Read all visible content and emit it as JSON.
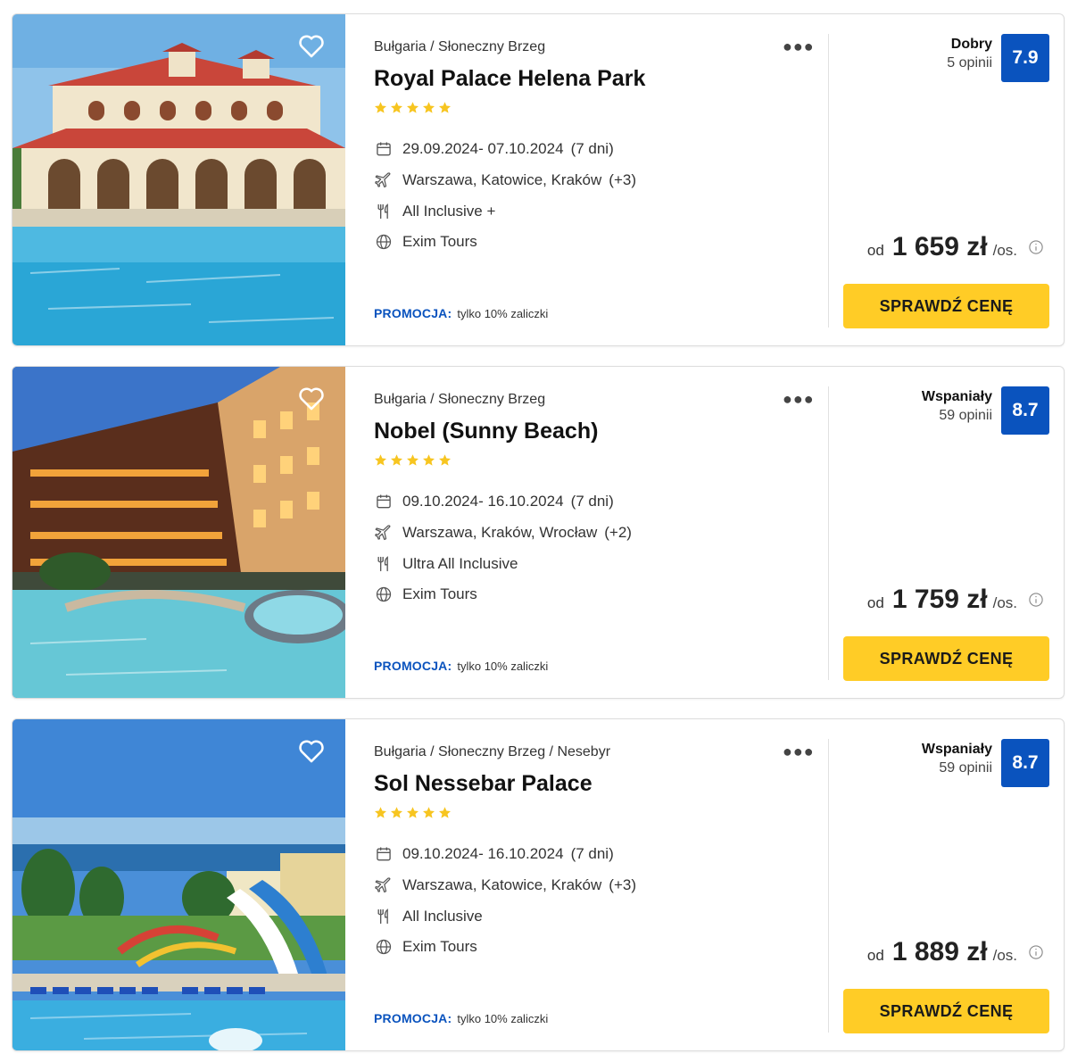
{
  "colors": {
    "brand_blue": "#0a53be",
    "cta_yellow": "#ffcc26",
    "star_yellow": "#f7c520"
  },
  "offers": [
    {
      "location": "Bułgaria / Słoneczny Brzeg",
      "name": "Royal Palace Helena Park",
      "stars": 5,
      "dates": "29.09.2024- 07.10.2024",
      "duration": "(7 dni)",
      "departures": "Warszawa, Katowice, Kraków",
      "departures_more": "(+3)",
      "board": "All Inclusive +",
      "operator": "Exim Tours",
      "promo_label": "PROMOCJA:",
      "promo_text": "tylko 10% zaliczki",
      "rating_word": "Dobry",
      "rating_count": "5 opinii",
      "rating_score": "7.9",
      "price_prefix": "od",
      "price": "1 659 zł",
      "price_suffix": "/os.",
      "cta": "SPRAWDŹ CENĘ",
      "icons": [
        "heart-icon",
        "more-dots-icon",
        "calendar-icon",
        "plane-icon",
        "cutlery-icon",
        "globe-icon",
        "info-icon"
      ]
    },
    {
      "location": "Bułgaria / Słoneczny Brzeg",
      "name": "Nobel (Sunny Beach)",
      "stars": 5,
      "dates": "09.10.2024- 16.10.2024",
      "duration": "(7 dni)",
      "departures": "Warszawa, Kraków, Wrocław",
      "departures_more": "(+2)",
      "board": "Ultra All Inclusive",
      "operator": "Exim Tours",
      "promo_label": "PROMOCJA:",
      "promo_text": "tylko 10% zaliczki",
      "rating_word": "Wspaniały",
      "rating_count": "59 opinii",
      "rating_score": "8.7",
      "price_prefix": "od",
      "price": "1 759 zł",
      "price_suffix": "/os.",
      "cta": "SPRAWDŹ CENĘ",
      "icons": [
        "heart-icon",
        "more-dots-icon",
        "calendar-icon",
        "plane-icon",
        "cutlery-icon",
        "globe-icon",
        "info-icon"
      ]
    },
    {
      "location": "Bułgaria / Słoneczny Brzeg / Nesebyr",
      "name": "Sol Nessebar Palace",
      "stars": 5,
      "dates": "09.10.2024- 16.10.2024",
      "duration": "(7 dni)",
      "departures": "Warszawa, Katowice, Kraków",
      "departures_more": "(+3)",
      "board": "All Inclusive",
      "operator": "Exim Tours",
      "promo_label": "PROMOCJA:",
      "promo_text": "tylko 10% zaliczki",
      "rating_word": "Wspaniały",
      "rating_count": "59 opinii",
      "rating_score": "8.7",
      "price_prefix": "od",
      "price": "1 889 zł",
      "price_suffix": "/os.",
      "cta": "SPRAWDŹ CENĘ",
      "icons": [
        "heart-icon",
        "more-dots-icon",
        "calendar-icon",
        "plane-icon",
        "cutlery-icon",
        "globe-icon",
        "info-icon"
      ]
    }
  ]
}
